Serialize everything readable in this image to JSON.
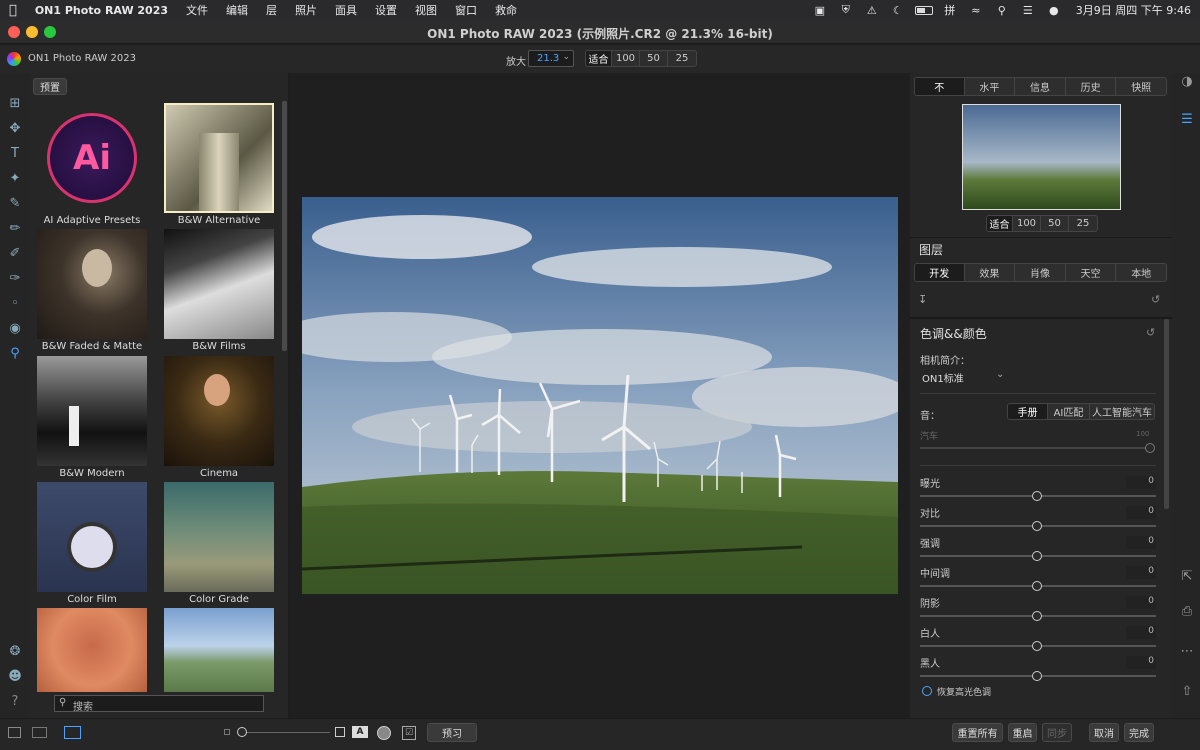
{
  "menubar": {
    "app": "ON1 Photo RAW 2023",
    "items": [
      "文件",
      "编辑",
      "层",
      "照片",
      "面具",
      "设置",
      "视图",
      "窗口",
      "救命"
    ],
    "clock": "3月9日 周四 下午 9:46"
  },
  "window": {
    "title": "ON1 Photo RAW 2023 (示例照片.CR2 @ 21.3% 16-bit)",
    "brand": "ON1 Photo RAW 2023"
  },
  "zoom": {
    "label": "放大",
    "value": "21.3",
    "options": [
      "适合",
      "100",
      "50",
      "25"
    ]
  },
  "browser": {
    "tab": "预置",
    "search_placeholder": "搜索",
    "presets": [
      {
        "label": "AI Adaptive Presets",
        "ai": "Ai"
      },
      {
        "label": "B&W Alternative"
      },
      {
        "label": "B&W Faded & Matte"
      },
      {
        "label": "B&W Films"
      },
      {
        "label": "B&W Modern"
      },
      {
        "label": "Cinema"
      },
      {
        "label": "Color Film"
      },
      {
        "label": "Color Grade"
      },
      {
        "label": ""
      },
      {
        "label": ""
      }
    ]
  },
  "right": {
    "tabs": [
      "不",
      "水平",
      "信息",
      "历史",
      "快照"
    ],
    "nav_zoom": [
      "适合",
      "100",
      "50",
      "25"
    ],
    "layers_title": "图层",
    "module_tabs": [
      "开发",
      "效果",
      "肖像",
      "天空",
      "本地"
    ],
    "section_title": "色调&&颜色",
    "camera_profile_label": "相机简介：",
    "camera_profile_value": "ON1标准",
    "tone_label": "音：",
    "tone_modes": [
      "手册",
      "AI匹配",
      "人工智能汽车"
    ],
    "auto_label": "汽车",
    "auto_value": "100",
    "sliders": [
      {
        "name": "曝光",
        "value": "0"
      },
      {
        "name": "对比",
        "value": "0"
      },
      {
        "name": "强调",
        "value": "0"
      },
      {
        "name": "中间调",
        "value": "0"
      },
      {
        "name": "阴影",
        "value": "0"
      },
      {
        "name": "白人",
        "value": "0"
      },
      {
        "name": "黑人",
        "value": "0"
      }
    ],
    "restore_highlights": "恢复高光色调"
  },
  "bottom": {
    "preview": "预习",
    "reset_all": "重置所有",
    "reset": "重启",
    "sync": "同步",
    "cancel": "取消",
    "done": "完成"
  }
}
